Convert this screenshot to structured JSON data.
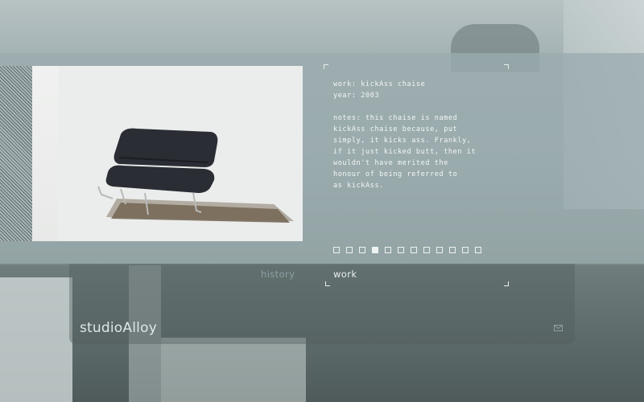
{
  "work": {
    "title_line": "work: kickAss chaise",
    "year_line": "year: 2003",
    "notes_lines": [
      "notes: this chaise is named",
      "kickAss chaise because, put",
      "simply, it kicks ass. Frankly,",
      "if it just kicked butt, then it",
      "wouldn't have merited the",
      "honour of being referred to",
      "as kickAss."
    ]
  },
  "pager": {
    "count": 12,
    "active_index": 3
  },
  "nav": {
    "history": "history",
    "work": "work"
  },
  "brand": "studioAlloy",
  "icons": {
    "mail": "mail-icon"
  }
}
